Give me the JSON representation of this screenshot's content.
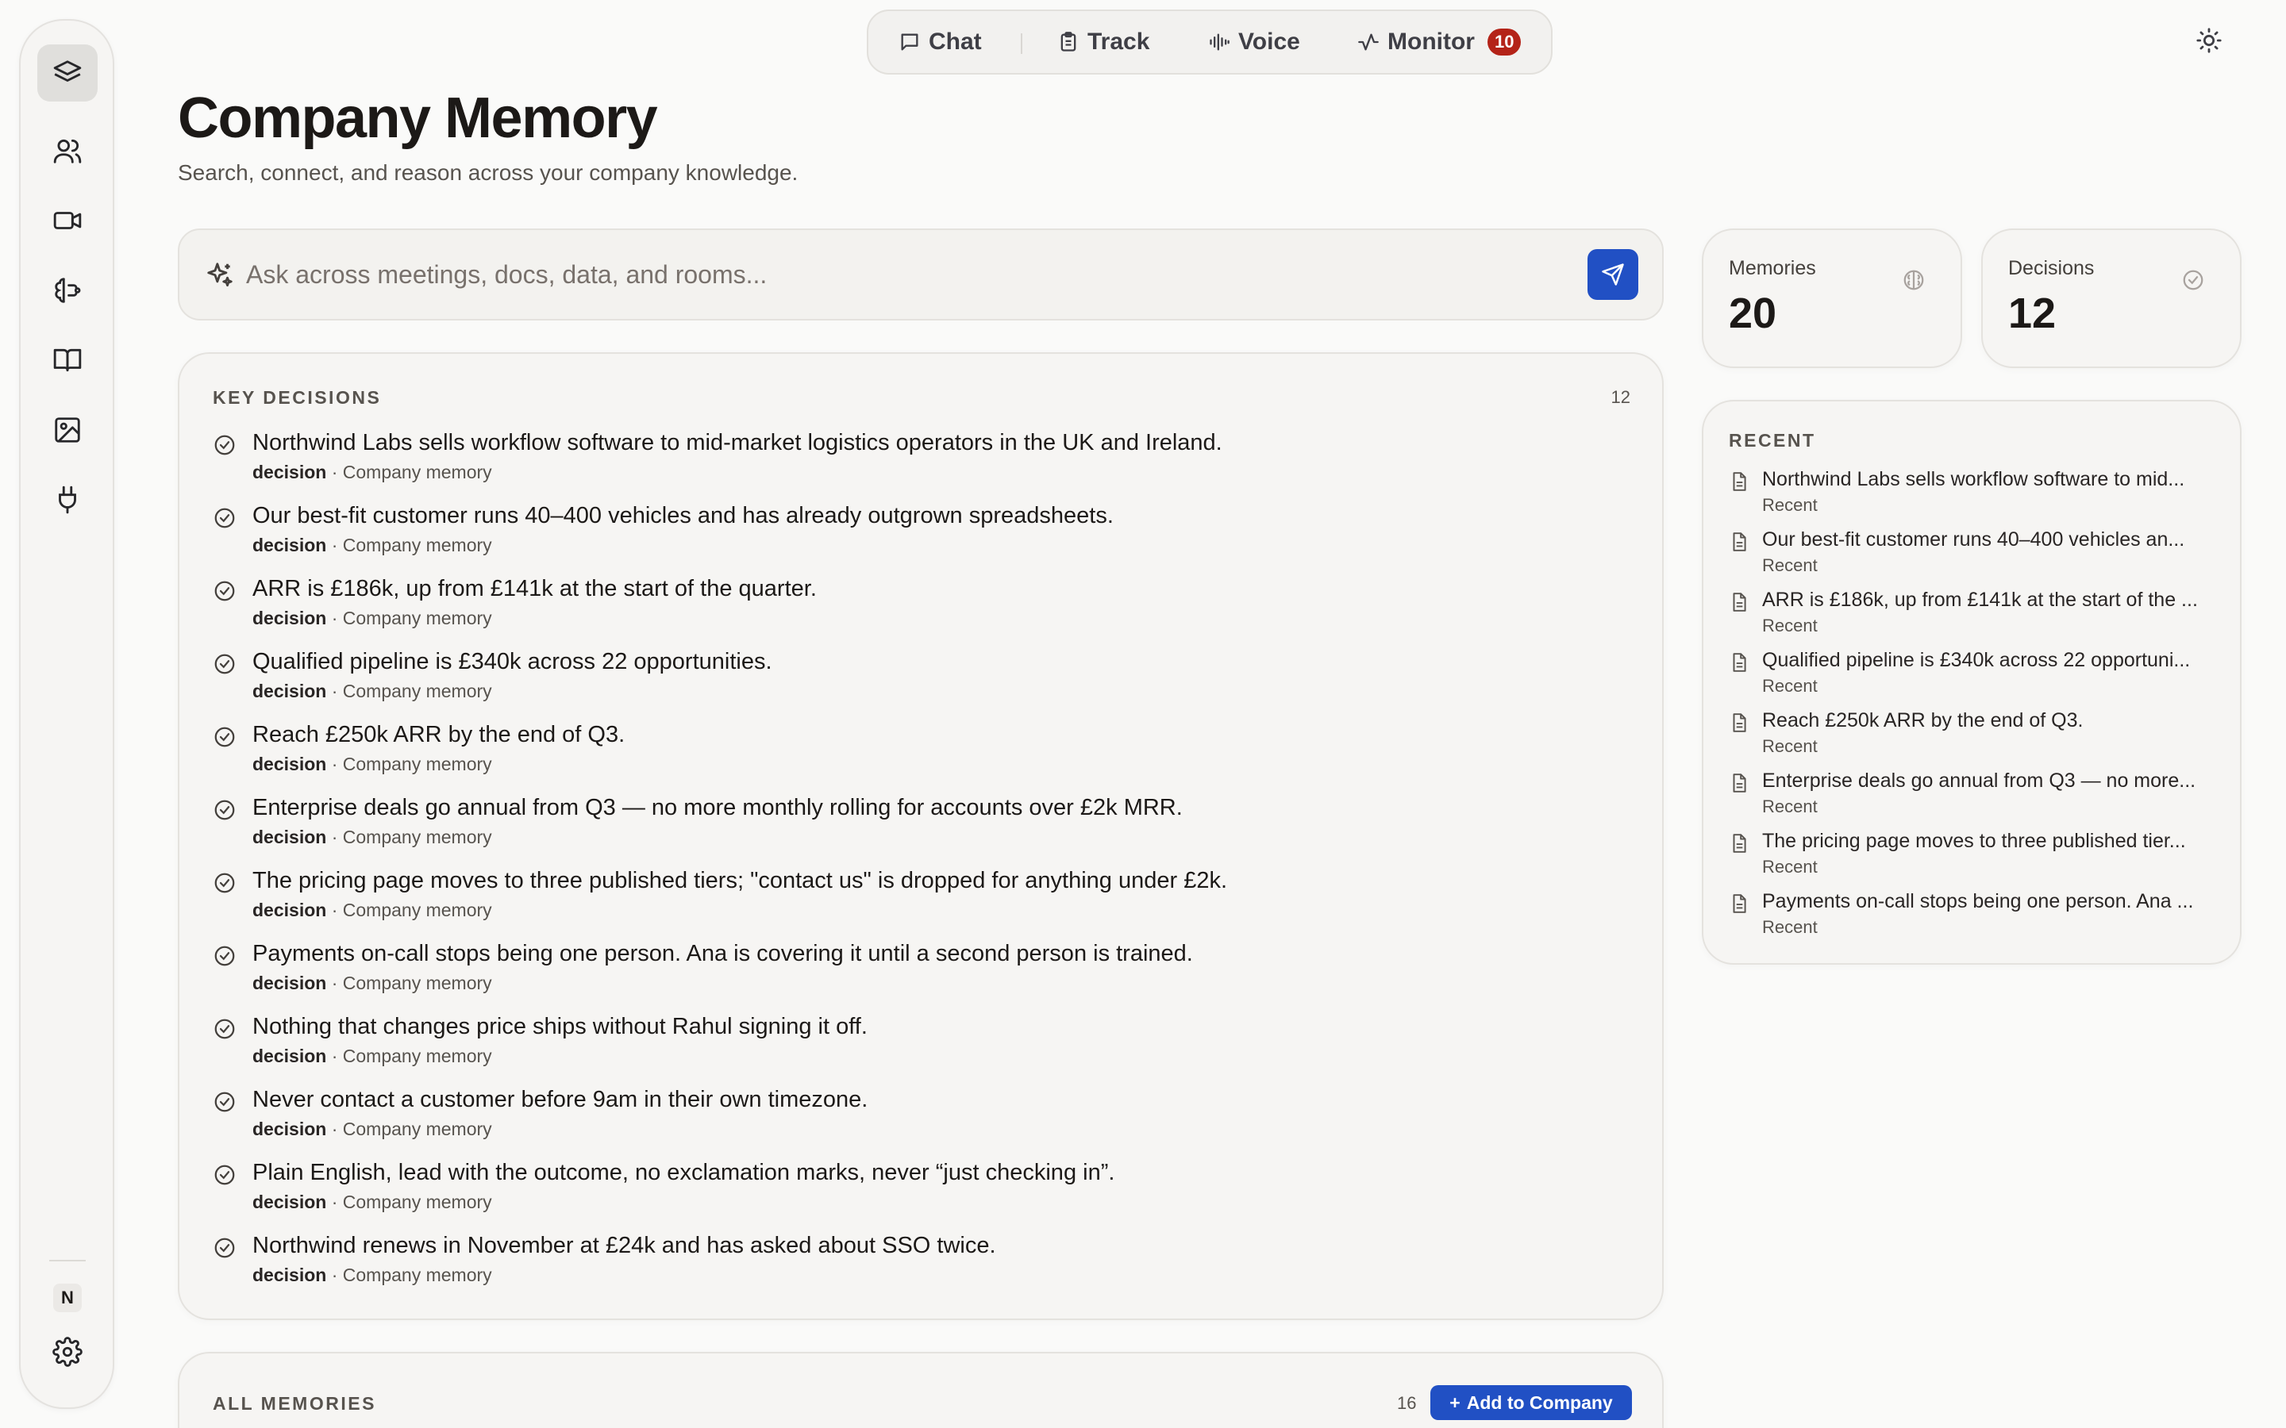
{
  "nav": {
    "items": [
      {
        "label": "Chat",
        "icon": "chat-icon"
      },
      {
        "label": "Track",
        "icon": "clipboard-icon"
      },
      {
        "label": "Voice",
        "icon": "waveform-icon"
      },
      {
        "label": "Monitor",
        "icon": "activity-icon",
        "badge": "10"
      }
    ]
  },
  "sidebar": {
    "items": [
      {
        "icon": "layers-icon",
        "active": true
      },
      {
        "icon": "users-icon"
      },
      {
        "icon": "video-icon"
      },
      {
        "icon": "brain-icon"
      },
      {
        "icon": "book-icon"
      },
      {
        "icon": "image-icon"
      },
      {
        "icon": "plug-icon"
      }
    ],
    "avatar": "N",
    "settings_icon": "gear-icon"
  },
  "header": {
    "title": "Company Memory",
    "subtitle": "Search, connect, and reason across your company knowledge."
  },
  "search": {
    "placeholder": "Ask across meetings, docs, data, and rooms..."
  },
  "decisions": {
    "label": "KEY DECISIONS",
    "count": "12",
    "items": [
      {
        "text": "Northwind Labs sells workflow software to mid-market logistics operators in the UK and Ireland.",
        "type": "decision",
        "source": "Company memory"
      },
      {
        "text": "Our best-fit customer runs 40–400 vehicles and has already outgrown spreadsheets.",
        "type": "decision",
        "source": "Company memory"
      },
      {
        "text": "ARR is £186k, up from £141k at the start of the quarter.",
        "type": "decision",
        "source": "Company memory"
      },
      {
        "text": "Qualified pipeline is £340k across 22 opportunities.",
        "type": "decision",
        "source": "Company memory"
      },
      {
        "text": "Reach £250k ARR by the end of Q3.",
        "type": "decision",
        "source": "Company memory"
      },
      {
        "text": "Enterprise deals go annual from Q3 — no more monthly rolling for accounts over £2k MRR.",
        "type": "decision",
        "source": "Company memory"
      },
      {
        "text": "The pricing page moves to three published tiers; \"contact us\" is dropped for anything under £2k.",
        "type": "decision",
        "source": "Company memory"
      },
      {
        "text": "Payments on-call stops being one person. Ana is covering it until a second person is trained.",
        "type": "decision",
        "source": "Company memory"
      },
      {
        "text": "Nothing that changes price ships without Rahul signing it off.",
        "type": "decision",
        "source": "Company memory"
      },
      {
        "text": "Never contact a customer before 9am in their own timezone.",
        "type": "decision",
        "source": "Company memory"
      },
      {
        "text": "Plain English, lead with the outcome, no exclamation marks, never “just checking in”.",
        "type": "decision",
        "source": "Company memory"
      },
      {
        "text": "Northwind renews in November at £24k and has asked about SSO twice.",
        "type": "decision",
        "source": "Company memory"
      }
    ]
  },
  "stats": {
    "memories": {
      "label": "Memories",
      "value": "20"
    },
    "decisions": {
      "label": "Decisions",
      "value": "12"
    }
  },
  "recent": {
    "label": "RECENT",
    "items": [
      {
        "text": "Northwind Labs sells workflow software to mid...",
        "sub": "Recent"
      },
      {
        "text": "Our best-fit customer runs 40–400 vehicles an...",
        "sub": "Recent"
      },
      {
        "text": "ARR is £186k, up from £141k at the start of the ...",
        "sub": "Recent"
      },
      {
        "text": "Qualified pipeline is £340k across 22 opportuni...",
        "sub": "Recent"
      },
      {
        "text": "Reach £250k ARR by the end of Q3.",
        "sub": "Recent"
      },
      {
        "text": "Enterprise deals go annual from Q3 — no more...",
        "sub": "Recent"
      },
      {
        "text": "The pricing page moves to three published tier...",
        "sub": "Recent"
      },
      {
        "text": "Payments on-call stops being one person. Ana ...",
        "sub": "Recent"
      }
    ]
  },
  "all_memories": {
    "label": "ALL MEMORIES",
    "count": "16",
    "add_label": "Add to Company"
  },
  "colors": {
    "accent": "#2150c4",
    "badge": "#b42318"
  }
}
